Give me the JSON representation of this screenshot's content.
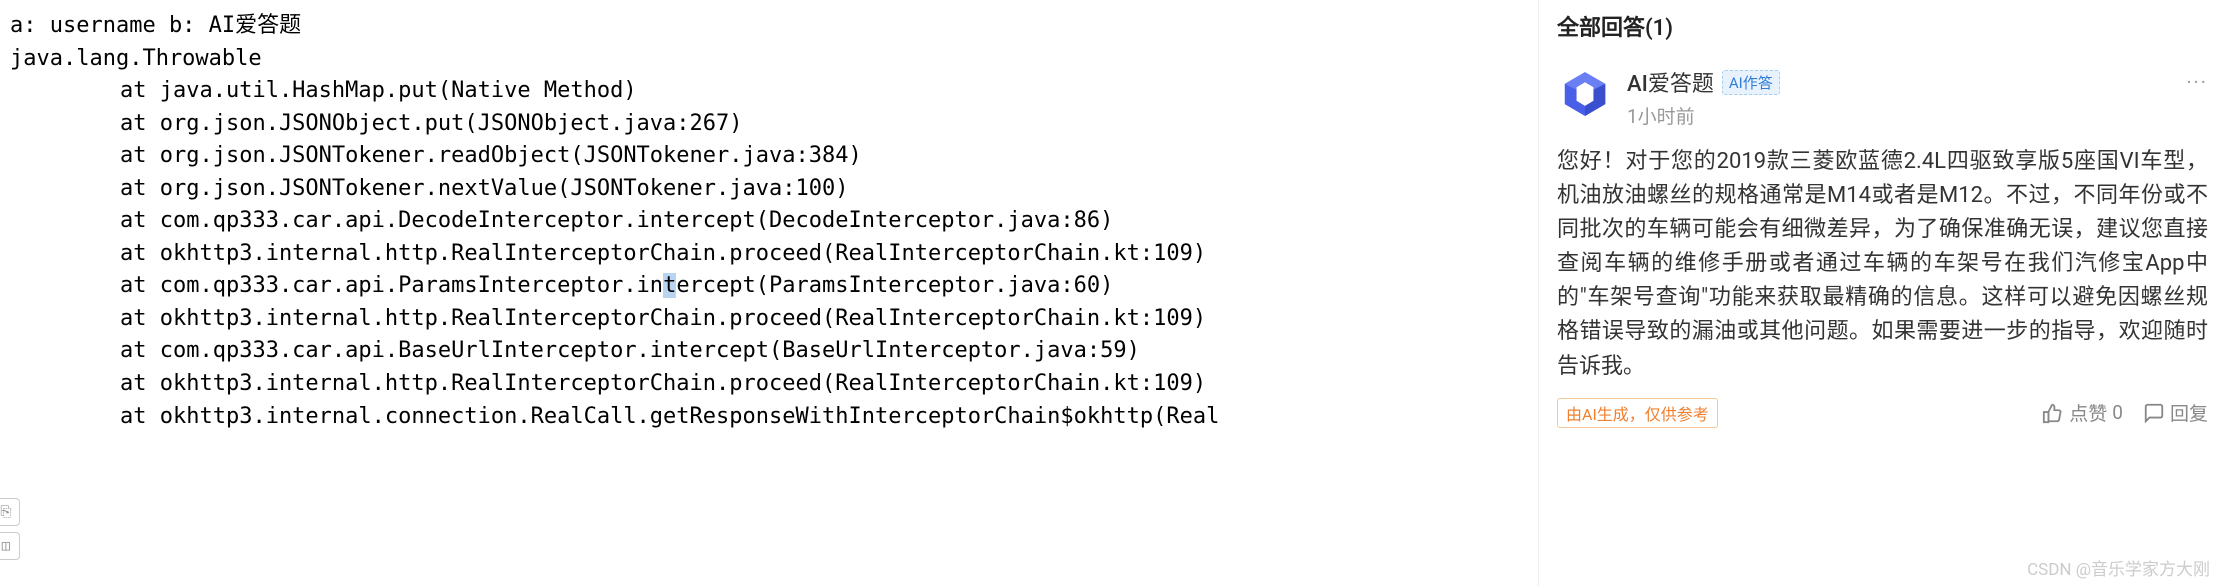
{
  "code": {
    "line1": "a: username b: AI爱答题",
    "line2": "java.lang.Throwable",
    "trace": [
      "at java.util.HashMap.put(Native Method)",
      "at org.json.JSONObject.put(JSONObject.java:267)",
      "at org.json.JSONTokener.readObject(JSONTokener.java:384)",
      "at org.json.JSONTokener.nextValue(JSONTokener.java:100)",
      "at com.qp333.car.api.DecodeInterceptor.intercept(DecodeInterceptor.java:86)",
      "at okhttp3.internal.http.RealInterceptorChain.proceed(RealInterceptorChain.kt:109)"
    ],
    "trace_split_pre": "at com.qp333.car.api.ParamsInterceptor.in",
    "trace_split_hl": "t",
    "trace_split_post": "ercept(ParamsInterceptor.java:60)",
    "trace2": [
      "at okhttp3.internal.http.RealInterceptorChain.proceed(RealInterceptorChain.kt:109)",
      "at com.qp333.car.api.BaseUrlInterceptor.intercept(BaseUrlInterceptor.java:59)",
      "at okhttp3.internal.http.RealInterceptorChain.proceed(RealInterceptorChain.kt:109)",
      "at okhttp3.internal.connection.RealCall.getResponseWithInterceptorChain$okhttp(Real"
    ]
  },
  "answers": {
    "header": "全部回答(1)",
    "author": "AI爱答题",
    "ai_badge": "AI作答",
    "time": "1小时前",
    "more": "···",
    "body": "您好！对于您的2019款三菱欧蓝德2.4L四驱致享版5座国VI车型，机油放油螺丝的规格通常是M14或者是M12。不过，不同年份或不同批次的车辆可能会有细微差异，为了确保准确无误，建议您直接查阅车辆的维修手册或者通过车辆的车架号在我们汽修宝App中的\"车架号查询\"功能来获取最精确的信息。这样可以避免因螺丝规格错误导致的漏油或其他问题。如果需要进一步的指导，欢迎随时告诉我。",
    "disclaimer": "由AI生成，仅供参考",
    "like_label": "点赞",
    "like_count": "0",
    "reply_label": "回复"
  },
  "watermark": "CSDN @音乐学家方大刚"
}
